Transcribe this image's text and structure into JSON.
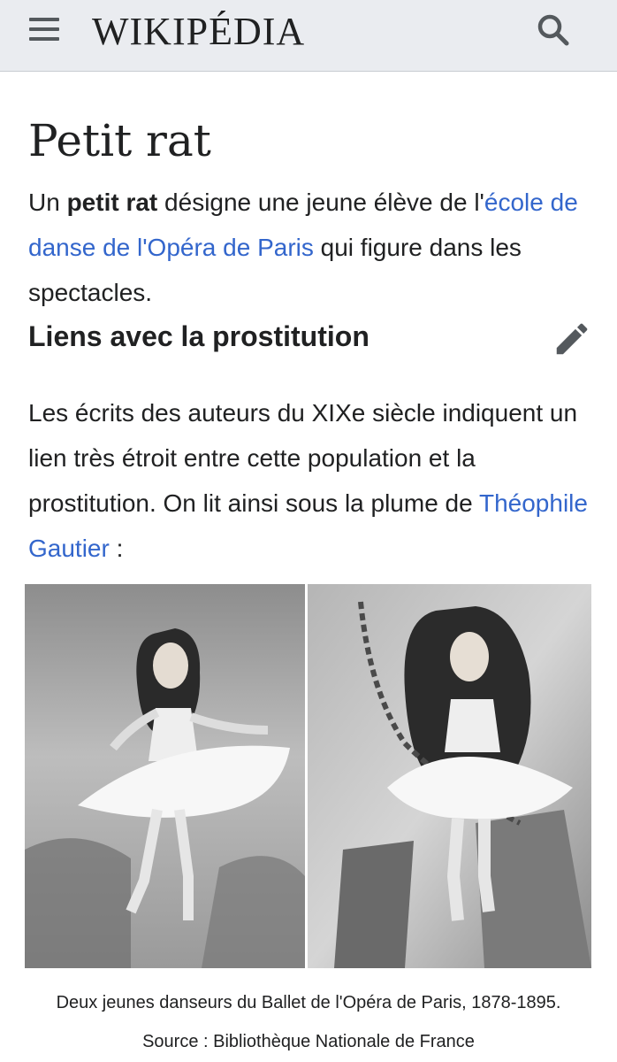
{
  "header": {
    "wordmark": "WIKIPÉDIA",
    "menu_icon": "hamburger-menu-icon",
    "search_icon": "search-icon"
  },
  "article": {
    "title": "Petit rat",
    "intro": {
      "prefix": "Un ",
      "bold": "petit rat",
      "middle": " désigne une jeune élève de l'",
      "link": "école de danse de l'Opéra de Paris",
      "suffix": " qui figure dans les spectacles."
    },
    "section": {
      "heading": "Liens avec la prostitution",
      "edit_icon": "pencil-edit-icon",
      "paragraph_text": "Les écrits des auteurs du XIXe siècle indiquent un lien très étroit entre cette population et la prostitution. On lit ainsi sous la plume de ",
      "paragraph_link": "Théophile Gautier",
      "paragraph_suffix": " :"
    },
    "figure": {
      "caption": "Deux jeunes danseurs du Ballet de l'Opéra de Paris, 1878-1895.",
      "source": "Source : Bibliothèque Nationale de France"
    }
  },
  "colors": {
    "link": "#3366cc",
    "header_bg": "#eaecf0",
    "text": "#202122",
    "icon": "#54595d"
  }
}
